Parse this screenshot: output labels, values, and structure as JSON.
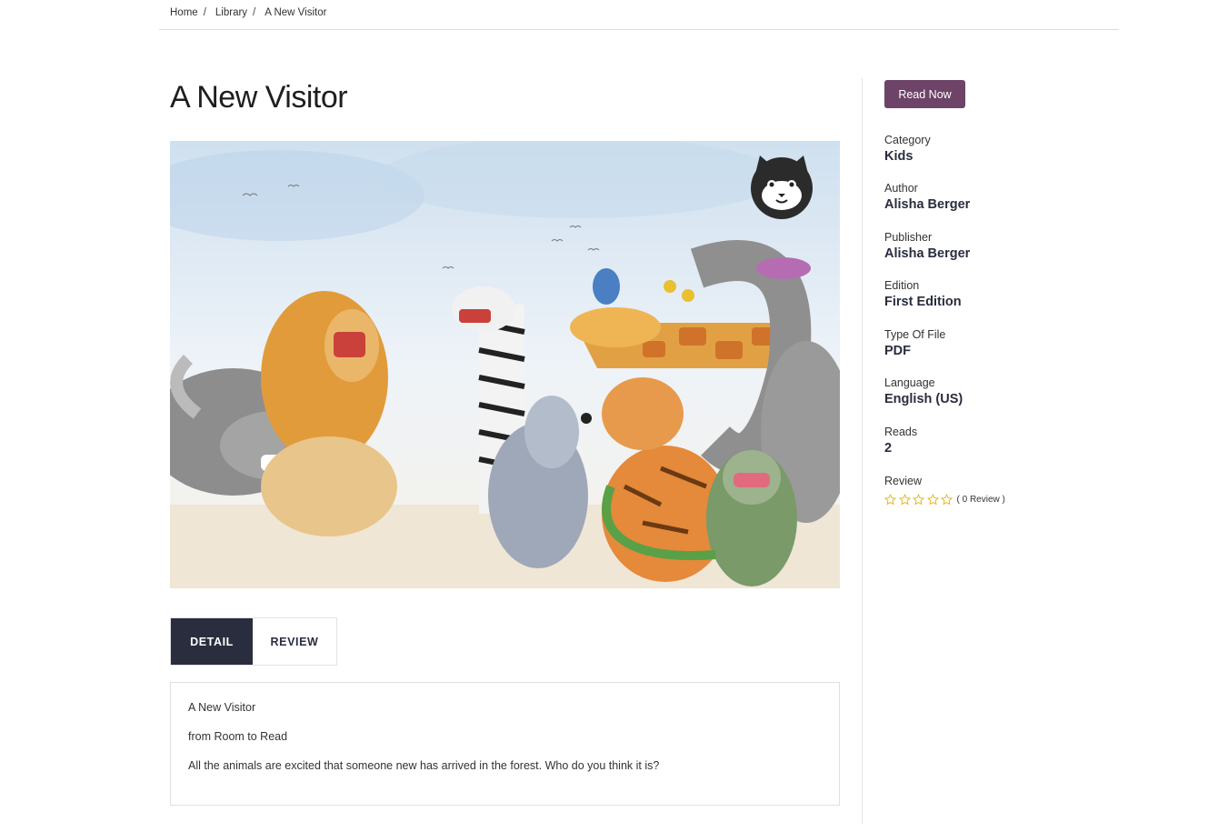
{
  "breadcrumb": {
    "items": [
      {
        "label": "Home",
        "separator": "/"
      },
      {
        "label": "Library",
        "separator": "/"
      },
      {
        "label": "A New Visitor"
      }
    ]
  },
  "book": {
    "title": "A New Visitor",
    "cover_icon": "cat-logo-icon"
  },
  "tabs": [
    {
      "label": "DETAIL",
      "active": true
    },
    {
      "label": "REVIEW",
      "active": false
    }
  ],
  "detail": {
    "lines": [
      "A New Visitor",
      "from Room to Read",
      "All the animals are excited that someone new has arrived in the forest. Who do you think it is?"
    ]
  },
  "sidebar": {
    "read_button": "Read Now",
    "category": {
      "label": "Category",
      "value": "Kids"
    },
    "author": {
      "label": "Author",
      "value": "Alisha Berger"
    },
    "publisher": {
      "label": "Publisher",
      "value": "Alisha Berger"
    },
    "edition": {
      "label": "Edition",
      "value": "First Edition"
    },
    "file_type": {
      "label": "Type Of File",
      "value": "PDF"
    },
    "language": {
      "label": "Language",
      "value": "English (US)"
    },
    "reads": {
      "label": "Reads",
      "value": "2"
    },
    "review": {
      "label": "Review",
      "rating": 0,
      "max_rating": 5,
      "count_text": "( 0 Review )"
    }
  },
  "colors": {
    "accent": "#6d4468",
    "dark": "#2a2d3e",
    "star": "#e5b72a"
  }
}
